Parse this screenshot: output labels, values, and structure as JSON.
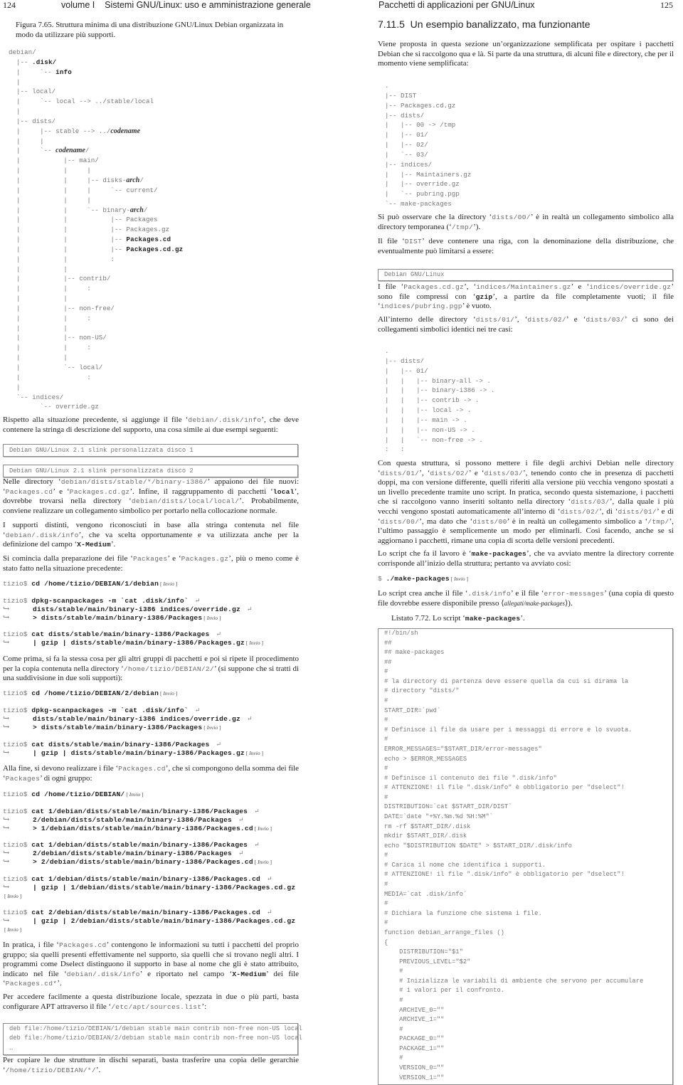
{
  "left_page": {
    "page_number": "124",
    "running_head": "volume I    Sistemi GNU/Linux: uso e amministrazione generale",
    "figure_caption": "Figura 7.65.  Struttura minima di una distribuzione GNU/Linux Debian organizzata in modo da utilizzare più supporti.",
    "tree": [
      "debian/",
      [
        [
          "t",
          "  |-- "
        ],
        [
          "cb",
          ".disk/"
        ]
      ],
      [
        [
          "t",
          "  |     `-- "
        ],
        [
          "cb",
          "info"
        ]
      ],
      "  |",
      "  |-- local/",
      "  |     `-- local --> ../stable/local",
      "  |",
      "  |-- dists/",
      [
        [
          "t",
          "  |     |-- stable --> ../"
        ],
        [
          "i",
          "codename"
        ]
      ],
      "  |     |",
      [
        [
          "t",
          "  |     `-- "
        ],
        [
          "i",
          "codename"
        ],
        [
          "t",
          "/"
        ]
      ],
      "  |           |-- main/",
      "  |           |     |",
      [
        [
          "t",
          "  |           |     |-- disks-"
        ],
        [
          "i",
          "arch"
        ],
        [
          "t",
          "/"
        ]
      ],
      "  |           |     |     `-- current/",
      "  |           |     |",
      [
        [
          "t",
          "  |           |     `-- binary-"
        ],
        [
          "i",
          "arch"
        ],
        [
          "t",
          "/"
        ]
      ],
      "  |           |           |-- Packages",
      "  |           |           |-- Packages.gz",
      [
        [
          "t",
          "  |           |           |-- "
        ],
        [
          "cb",
          "Packages.cd"
        ]
      ],
      [
        [
          "t",
          "  |           |           |-- "
        ],
        [
          "cb",
          "Packages.cd.gz"
        ]
      ],
      "  |           |           :",
      "  |           |",
      "  |           |-- contrib/",
      "  |           |     :",
      "  |           |",
      "  |           |-- non-free/",
      "  |           |     :",
      "  |           |",
      "  |           |-- non-US/",
      "  |           |     :",
      "  |           |",
      "  |           `-- local/",
      "  |                 :",
      "  |",
      "  `-- indices/",
      "        `-- override.gz"
    ],
    "p1": [
      [
        "t",
        "Rispetto alla situazione precedente, si aggiunge il file ‘"
      ],
      [
        "c",
        "debian/.disk/info"
      ],
      [
        "t",
        "’, che deve contenere la stringa di descrizione del supporto, una cosa simile ai due esempi seguenti:"
      ]
    ],
    "box1": [
      "Debian GNU/Linux 2.1 slink personalizzata disco 1"
    ],
    "box2": [
      "Debian GNU/Linux 2.1 slink personalizzata disco 2"
    ],
    "p2": [
      [
        "t",
        "Nelle directory ‘"
      ],
      [
        "c",
        "debian/dists/stable/*/binary-i386/"
      ],
      [
        "t",
        "’ appaiono dei file nuovi: ‘"
      ],
      [
        "c",
        "Packages.cd"
      ],
      [
        "t",
        "’ e ‘"
      ],
      [
        "c",
        "Packages.cd.gz"
      ],
      [
        "t",
        "’. Infine, il raggruppamento di pacchetti ‘"
      ],
      [
        "cb",
        "local"
      ],
      [
        "t",
        "’, dovrebbe trovarsi nella directory ‘"
      ],
      [
        "c",
        "debian/dists/local/local/"
      ],
      [
        "t",
        "’. Probabilmente, conviene realizzare un collegamento simbolico per portarlo nella collocazione normale."
      ]
    ],
    "p3": [
      [
        "t",
        "I supporti distinti, vengono riconosciuti in base alla stringa contenuta nel file ‘"
      ],
      [
        "c",
        "debian/.disk/info"
      ],
      [
        "t",
        "’, che va scelta opportunamente e va utilizzata anche per la definizione del campo ‘"
      ],
      [
        "cb",
        "X-Medium"
      ],
      [
        "t",
        "’."
      ]
    ],
    "p4": [
      [
        "t",
        "Si comincia dalla preparazione dei file ‘"
      ],
      [
        "c",
        "Packages"
      ],
      [
        "t",
        "’ e ‘"
      ],
      [
        "c",
        "Packages.gz"
      ],
      [
        "t",
        "’, più o meno come è stato fatto nella situazione precedente:"
      ]
    ],
    "cmd1": [
      [
        [
          "p",
          "tizio$ "
        ],
        [
          "cb",
          "cd /home/tizio/DEBIAN/1/debian"
        ],
        [
          "k",
          "Invio"
        ]
      ]
    ],
    "cmd2": [
      [
        [
          "p",
          "tizio$ "
        ],
        [
          "cb",
          "dpkg-scanpackages -m `cat .disk/info` "
        ],
        [
          "e",
          "↵"
        ]
      ],
      [
        [
          "a",
          "↪"
        ],
        [
          "cb",
          "dists/stable/main/binary-i386 indices/override.gz "
        ],
        [
          "e",
          "↵"
        ]
      ],
      [
        [
          "a",
          "↪"
        ],
        [
          "cb",
          "> dists/stable/main/binary-i386/Packages"
        ],
        [
          "k",
          "Invio"
        ]
      ]
    ],
    "cmd3": [
      [
        [
          "p",
          "tizio$ "
        ],
        [
          "cb",
          "cat dists/stable/main/binary-i386/Packages "
        ],
        [
          "e",
          "↵"
        ]
      ],
      [
        [
          "a",
          "↪"
        ],
        [
          "cb",
          "| gzip | dists/stable/main/binary-i386/Packages.gz"
        ],
        [
          "k",
          "Invio"
        ]
      ]
    ],
    "p5": [
      [
        "t",
        "Come prima, si fa la stessa cosa per gli altri gruppi di pacchetti e poi si ripete il procedimento per la copia contenuta nella directory ‘"
      ],
      [
        "c",
        "/home/tizio/DEBIAN/2/"
      ],
      [
        "t",
        "’ (si suppone che si tratti di una suddivisione in due soli supporti):"
      ]
    ],
    "cmd4": [
      [
        [
          "p",
          "tizio$ "
        ],
        [
          "cb",
          "cd /home/tizio/DEBIAN/2/debian"
        ],
        [
          "k",
          "Invio"
        ]
      ]
    ],
    "cmd5": [
      [
        [
          "p",
          "tizio$ "
        ],
        [
          "cb",
          "dpkg-scanpackages -m `cat .disk/info` "
        ],
        [
          "e",
          "↵"
        ]
      ],
      [
        [
          "a",
          "↪"
        ],
        [
          "cb",
          "dists/stable/main/binary-i386 indices/override.gz "
        ],
        [
          "e",
          "↵"
        ]
      ],
      [
        [
          "a",
          "↪"
        ],
        [
          "cb",
          "> dists/stable/main/binary-i386/Packages"
        ],
        [
          "k",
          "Invio"
        ]
      ]
    ],
    "cmd6": [
      [
        [
          "p",
          "tizio$ "
        ],
        [
          "cb",
          "cat dists/stable/main/binary-i386/Packages "
        ],
        [
          "e",
          "↵"
        ]
      ],
      [
        [
          "a",
          "↪"
        ],
        [
          "cb",
          "| gzip | dists/stable/main/binary-i386/Packages.gz"
        ],
        [
          "k",
          "Invio"
        ]
      ]
    ],
    "p6": [
      [
        "t",
        "Alla fine, si devono realizzare i file ‘"
      ],
      [
        "c",
        "Packages.cd"
      ],
      [
        "t",
        "’, che si compongono della somma dei file ‘"
      ],
      [
        "c",
        "Packages"
      ],
      [
        "t",
        "’ di ogni gruppo:"
      ]
    ],
    "cmd7": [
      [
        [
          "p",
          "tizio$ "
        ],
        [
          "cb",
          "cd /home/tizio/DEBIAN/"
        ],
        [
          "k",
          "Invio"
        ]
      ]
    ],
    "cmd8": [
      [
        [
          "p",
          "tizio$ "
        ],
        [
          "cb",
          "cat 1/debian/dists/stable/main/binary-i386/Packages "
        ],
        [
          "e",
          "↵"
        ]
      ],
      [
        [
          "a",
          "↪"
        ],
        [
          "cb",
          "2/debian/dists/stable/main/binary-i386/Packages "
        ],
        [
          "e",
          "↵"
        ]
      ],
      [
        [
          "a",
          "↪"
        ],
        [
          "cb",
          "> 1/debian/dists/stable/main/binary-i386/Packages.cd"
        ],
        [
          "k",
          "Invio"
        ]
      ]
    ],
    "cmd9": [
      [
        [
          "p",
          "tizio$ "
        ],
        [
          "cb",
          "cat 1/debian/dists/stable/main/binary-i386/Packages "
        ],
        [
          "e",
          "↵"
        ]
      ],
      [
        [
          "a",
          "↪"
        ],
        [
          "cb",
          "2/debian/dists/stable/main/binary-i386/Packages "
        ],
        [
          "e",
          "↵"
        ]
      ],
      [
        [
          "a",
          "↪"
        ],
        [
          "cb",
          "> 2/debian/dists/stable/main/binary-i386/Packages.cd"
        ],
        [
          "k",
          "Invio"
        ]
      ]
    ],
    "cmd10": [
      [
        [
          "p",
          "tizio$ "
        ],
        [
          "cb",
          "cat 1/debian/dists/stable/main/binary-i386/Packages.cd "
        ],
        [
          "e",
          "↵"
        ]
      ],
      [
        [
          "a",
          "↪"
        ],
        [
          "cb",
          "| gzip | 1/debian/dists/stable/main/binary-i386/Packages.cd.gz"
        ]
      ],
      [
        [
          "k",
          "Invio"
        ]
      ]
    ],
    "cmd11": [
      [
        [
          "p",
          "tizio$ "
        ],
        [
          "cb",
          "cat 2/debian/dists/stable/main/binary-i386/Packages.cd "
        ],
        [
          "e",
          "↵"
        ]
      ],
      [
        [
          "a",
          "↪"
        ],
        [
          "cb",
          "| gzip | 2/debian/dists/stable/main/binary-i386/Packages.cd.gz"
        ]
      ],
      [
        [
          "k",
          "Invio"
        ]
      ]
    ],
    "p7": [
      [
        "t",
        "In pratica, i file ‘"
      ],
      [
        "c",
        "Packages.cd"
      ],
      [
        "t",
        "’ contengono le informazioni su tutti i pacchetti del proprio gruppo; sia quelli presenti effettivamente nel supporto, sia quelli che si trovano negli altri. I programmi come Dselect distinguono il supporto in base al nome che gli è stato attribuito, indicato nel file ‘"
      ],
      [
        "c",
        "debian/.disk/info"
      ],
      [
        "t",
        "’ e riportato nel campo ‘"
      ],
      [
        "cb",
        "X-Medium"
      ],
      [
        "t",
        "’ dei file ‘"
      ],
      [
        "c",
        "Packages.cd*"
      ],
      [
        "t",
        "’."
      ]
    ],
    "p8": [
      [
        "t",
        "Per accedere facilmente a questa distribuzione locale, spezzata in due o più parti, basta configurare APT attraverso il file ‘"
      ],
      [
        "c",
        "/etc/apt/sources.list"
      ],
      [
        "t",
        "’:"
      ]
    ],
    "box3": [
      "deb file:/home/tizio/DEBIAN/1/debian stable main contrib non-free non-US local",
      "deb file:/home/tizio/DEBIAN/2/debian stable main contrib non-free non-US local",
      "…"
    ],
    "p9": [
      [
        "t",
        "Per copiare le due strutture in dischi separati, basta trasferire una copia delle gerarchie ‘"
      ],
      [
        "c",
        "/home/tizio/DEBIAN/*/"
      ],
      [
        "t",
        "’."
      ]
    ]
  },
  "right_page": {
    "running_head": "Pacchetti di applicazioni per GNU/Linux",
    "page_number": "125",
    "section_title": "7.11.5  Un esempio banalizzato, ma funzionante",
    "p1": [
      [
        "t",
        "Viene proposta in questa sezione un’organizzazione semplificata per ospitare i pacchetti Debian che si raccolgono qua e là. Si parte da una struttura, di alcuni file e directory, che per il momento viene semplificata:"
      ]
    ],
    "tree1": [
      ".",
      "|-- DIST",
      "|-- Packages.cd.gz",
      "|-- dists/",
      "|   |-- 00 -> /tmp",
      "|   |-- 01/",
      "|   |-- 02/",
      "|   `-- 03/",
      "|-- indices/",
      "|   |-- Maintainers.gz",
      "|   |-- override.gz",
      "|   `-- pubring.pgp",
      "`-- make-packages"
    ],
    "p2": [
      [
        "t",
        "Si può osservare che la directory ‘"
      ],
      [
        "c",
        "dists/00/"
      ],
      [
        "t",
        "’ è in realtà un collegamento simbolico alla directory temporanea (‘"
      ],
      [
        "c",
        "/tmp/"
      ],
      [
        "t",
        "’)."
      ]
    ],
    "p3": [
      [
        "t",
        "Il file ‘"
      ],
      [
        "c",
        "DIST"
      ],
      [
        "t",
        "’ deve contenere una riga, con la denominazione della distribuzione, che eventualmente può limitarsi a essere:"
      ]
    ],
    "box1": [
      "Debian GNU/Linux"
    ],
    "p4": [
      [
        "t",
        "I file ‘"
      ],
      [
        "c",
        "Packages.cd.gz"
      ],
      [
        "t",
        "’, ‘"
      ],
      [
        "c",
        "indices/Maintainers.gz"
      ],
      [
        "t",
        "’ e ‘"
      ],
      [
        "c",
        "indices/override.gz"
      ],
      [
        "t",
        "’ sono file compressi con ‘"
      ],
      [
        "cb",
        "gzip"
      ],
      [
        "t",
        "’, a partire da file completamente vuoti; il file ‘"
      ],
      [
        "c",
        "indices/pubring.pgp"
      ],
      [
        "t",
        "’ è vuoto."
      ]
    ],
    "p5": [
      [
        "t",
        "All’interno delle directory ‘"
      ],
      [
        "c",
        "dists/01/"
      ],
      [
        "t",
        "’, ‘"
      ],
      [
        "c",
        "dists/02/"
      ],
      [
        "t",
        "’ e ‘"
      ],
      [
        "c",
        "dists/03/"
      ],
      [
        "t",
        "’ ci sono dei collegamenti simbolici identici nei tre casi:"
      ]
    ],
    "tree2": [
      ".",
      "|-- dists/",
      "|   |-- 01/",
      "|   |   |-- binary-all -> .",
      "|   |   |-- binary-i386 -> .",
      "|   |   |-- contrib -> .",
      "|   |   |-- local -> .",
      "|   |   |-- main -> .",
      "|   |   |-- non-US -> .",
      "|   |   `-- non-free -> .",
      ":   :"
    ],
    "p6": [
      [
        "t",
        "Con questa struttura, si possono mettere i file degli archivi Debian nelle directory ‘"
      ],
      [
        "c",
        "dists/01/"
      ],
      [
        "t",
        "’, ‘"
      ],
      [
        "c",
        "dists/02/"
      ],
      [
        "t",
        "’ e ‘"
      ],
      [
        "c",
        "dists/03/"
      ],
      [
        "t",
        "’, tenendo conto che in presenza di pacchetti doppi, ma con versione differente, quelli riferiti alla versione più vecchia vengono spostati a un livello precedente tramite uno script. In pratica, secondo questa sistemazione, i pacchetti che si raccolgono vanno inseriti soltanto nella directory ‘"
      ],
      [
        "c",
        "dists/03/"
      ],
      [
        "t",
        "’, dalla quale i più vecchi vengono spostati automaticamente all’interno di ‘"
      ],
      [
        "c",
        "dists/02/"
      ],
      [
        "t",
        "’, di ‘"
      ],
      [
        "c",
        "dists/01/"
      ],
      [
        "t",
        "’ e di ‘"
      ],
      [
        "c",
        "dists/00/"
      ],
      [
        "t",
        "’, ma dato che ‘"
      ],
      [
        "c",
        "dists/00"
      ],
      [
        "t",
        "’ è in realtà un collegamento simbolico a ‘"
      ],
      [
        "c",
        "/tmp/"
      ],
      [
        "t",
        "’, l’ultimo passaggio è semplicemente un modo per eliminarli. Così facendo, anche se si aggiornano i pacchetti, rimane una copia di scorta delle versioni precedenti."
      ]
    ],
    "p7": [
      [
        "t",
        "Lo script che fa il lavoro è ‘"
      ],
      [
        "cb",
        "make-packages"
      ],
      [
        "t",
        "’, che va avviato mentre la directory corrente corrisponde all’inizio della struttura; pertanto va avviato così:"
      ]
    ],
    "cmd1": [
      [
        [
          "p",
          "$ "
        ],
        [
          "cb",
          "./make-packages"
        ],
        [
          "k",
          "Invio"
        ]
      ]
    ],
    "p8": [
      [
        "t",
        "Lo script crea anche il file ‘"
      ],
      [
        "c",
        ".disk/info"
      ],
      [
        "t",
        "’ e il file ‘"
      ],
      [
        "c",
        "error-messages"
      ],
      [
        "t",
        "’ (una copia di questo file dovrebbe essere disponibile presso ⟨"
      ],
      [
        "ii",
        "allegati/make-packages"
      ],
      [
        "t",
        "⟩)."
      ]
    ],
    "listing_caption": [
      [
        "t",
        "Listato 7.72. Lo script ‘"
      ],
      [
        "cb",
        "make-packages"
      ],
      [
        "t",
        "’."
      ]
    ],
    "listing": [
      "#!/bin/sh",
      "##",
      "## make-packages",
      "##",
      "#",
      "# la directory di partenza deve essere quella da cui si dirama la",
      "# directory \"dists/\"",
      "#",
      "START_DIR=`pwd`",
      "#",
      "# Definisce il file da usare per i messaggi di errore e lo svuota.",
      "#",
      "ERROR_MESSAGES=\"$START_DIR/error-messages\"",
      "echo > $ERROR_MESSAGES",
      "#",
      "# Definisce il contenuto dei file \".disk/info\"",
      "# ATTENZIONE! il file \".disk/info\" è obbligatorio per \"dselect\"!",
      "#",
      "DISTRIBUTION=`cat $START_DIR/DIST`",
      "DATE=`date \"+%Y.%m.%d %H:%M\"`",
      "rm -rf $START_DIR/.disk",
      "mkdir $START_DIR/.disk",
      "echo \"$DISTRIBUTION $DATE\" > $START_DIR/.disk/info",
      "#",
      "# Carica il nome che identifica i supporti.",
      "# ATTENZIONE! il file \".disk/info\" è obbligatorio per \"dselect\"!",
      "#",
      "MEDIA=`cat .disk/info`",
      "#",
      "# Dichiara la funzione che sistema i file.",
      "#",
      "function debian_arrange_files ()",
      "{",
      "    DISTRIBUTION=\"$1\"",
      "    PREVIOUS_LEVEL=\"$2\"",
      "    #",
      "    # Inizializza le variabili di ambiente che servono per accumulare",
      "    # i valori per il confronto.",
      "    #",
      "    ARCHIVE_0=\"\"",
      "    ARCHIVE_1=\"\"",
      "    #",
      "    PACKAGE_0=\"\"",
      "    PACKAGE_1=\"\"",
      "    #",
      "    VERSION_0=\"\"",
      "    VERSION_1=\"\""
    ]
  }
}
